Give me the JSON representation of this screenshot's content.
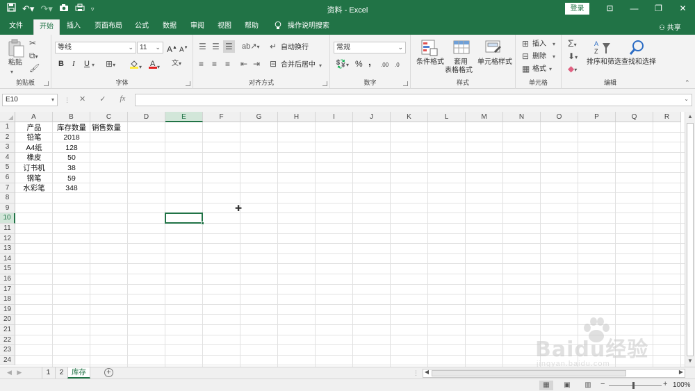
{
  "window": {
    "title": "资料 - Excel",
    "login_label": "登录",
    "share_label": "共享"
  },
  "menu": {
    "tabs": [
      "文件",
      "开始",
      "插入",
      "页面布局",
      "公式",
      "数据",
      "审阅",
      "视图",
      "帮助"
    ],
    "active_tab": "开始",
    "tell_me": "操作说明搜索"
  },
  "ribbon": {
    "clipboard": {
      "paste": "粘贴",
      "label": "剪贴板"
    },
    "font": {
      "name": "等线",
      "size": "11",
      "label": "字体",
      "bold": "B",
      "italic": "I",
      "underline": "U",
      "grow": "A",
      "shrink": "A"
    },
    "alignment": {
      "wrap": "自动换行",
      "merge": "合并后居中",
      "label": "对齐方式"
    },
    "number": {
      "format": "常规",
      "label": "数字",
      "percent": "%",
      "comma": ",",
      "inc_dec": ".00",
      "dec_dec": ".0"
    },
    "styles": {
      "conditional": "条件格式",
      "table_line1": "套用",
      "table_line2": "表格格式",
      "cell_style": "单元格样式",
      "label": "样式"
    },
    "cells": {
      "insert": "插入",
      "delete": "删除",
      "format": "格式",
      "label": "单元格"
    },
    "editing": {
      "sort": "排序和筛选",
      "find": "查找和选择",
      "label": "编辑"
    }
  },
  "formula_bar": {
    "name_box": "E10",
    "fx": "fx",
    "content": ""
  },
  "grid": {
    "columns": [
      "A",
      "B",
      "C",
      "D",
      "E",
      "F",
      "G",
      "H",
      "I",
      "J",
      "K",
      "L",
      "M",
      "N",
      "O",
      "P",
      "Q",
      "R"
    ],
    "rows": [
      "1",
      "2",
      "3",
      "4",
      "5",
      "6",
      "7",
      "8",
      "9",
      "10",
      "11",
      "12",
      "13",
      "14",
      "15",
      "16",
      "17",
      "18",
      "19",
      "20",
      "21",
      "22",
      "23",
      "24"
    ],
    "selected_column": "E",
    "selected_row": "10",
    "cells": {
      "A1": "产品",
      "B1": "库存数量",
      "C1": "销售数量",
      "A2": "铅笔",
      "B2": "2018",
      "A3": "A4纸",
      "B3": "128",
      "A4": "橡皮",
      "B4": "50",
      "A5": "订书机",
      "B5": "38",
      "A6": "钢笔",
      "B6": "59",
      "A7": "水彩笔",
      "B7": "348"
    }
  },
  "sheets": {
    "tabs": [
      "1",
      "2",
      "库存"
    ],
    "active": "库存"
  },
  "status": {
    "zoom": "100%",
    "zoom_level": 1.0
  },
  "watermark": {
    "main": "Baidu经验",
    "sub": "jingyan.baidu.com"
  },
  "colors": {
    "accent": "#217346",
    "ribbon_bg": "#f3f3f3",
    "font_color_red": "#e02020",
    "highlight_yellow": "#ffeb3b"
  }
}
